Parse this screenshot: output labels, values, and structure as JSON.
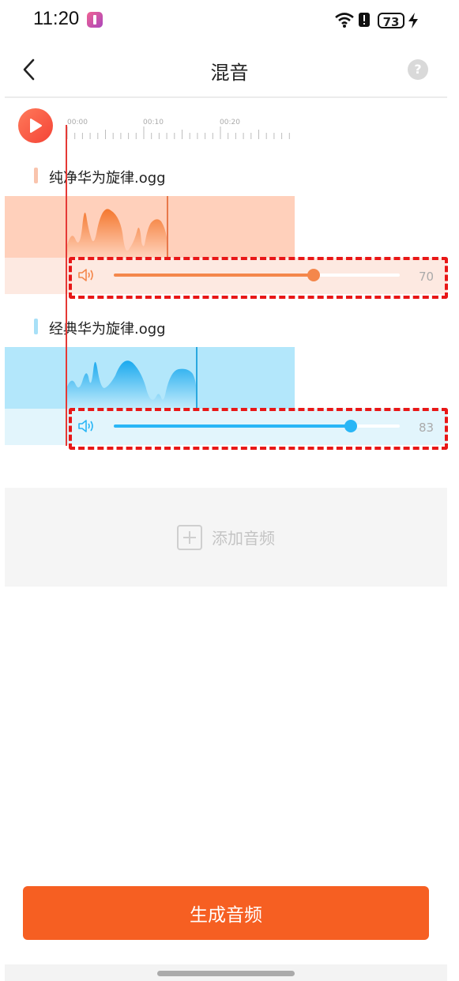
{
  "status_bar": {
    "time": "11:20",
    "battery": "73",
    "icons": [
      "wifi-icon",
      "alert-icon",
      "charging-icon"
    ]
  },
  "header": {
    "title": "混音",
    "help_label": "?",
    "back_icon": "chevron-left-icon"
  },
  "timeline": {
    "ticks": [
      "00:00",
      "00:10",
      "00:20"
    ],
    "play_icon": "play-icon"
  },
  "tracks": [
    {
      "name": "纯净华为旋律.ogg",
      "volume": "70",
      "volume_fraction": 0.7,
      "color": "#f4874b",
      "light_color": "#ffd0bb",
      "pale_color": "#fde9e1",
      "marker_color": "#f9c4ad"
    },
    {
      "name": "经典华为旋律.ogg",
      "volume": "83",
      "volume_fraction": 0.83,
      "color": "#29b6f6",
      "light_color": "#b3e7fb",
      "pale_color": "#e2f5fc",
      "marker_color": "#a8e0f7"
    }
  ],
  "add_audio": {
    "label": "添加音频"
  },
  "generate_button": {
    "label": "生成音频",
    "color": "#f65f22"
  }
}
